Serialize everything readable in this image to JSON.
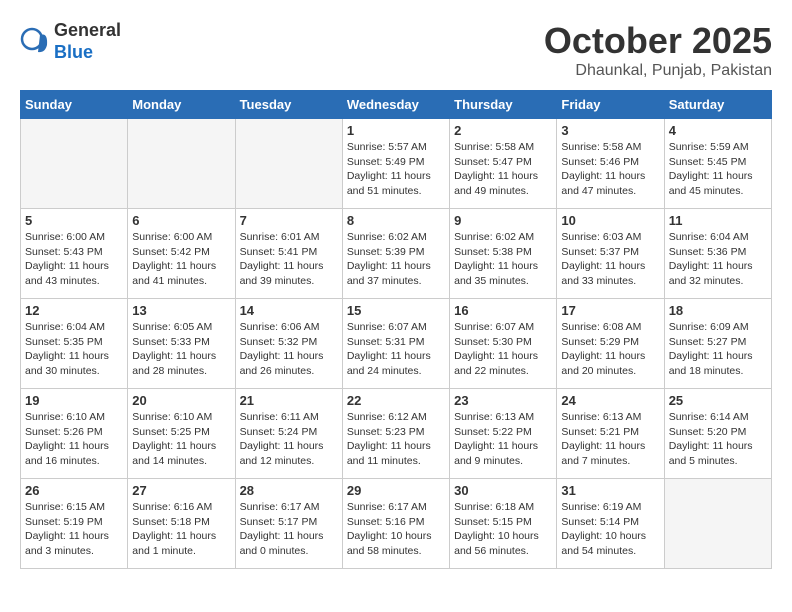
{
  "header": {
    "logo_general": "General",
    "logo_blue": "Blue",
    "month": "October 2025",
    "location": "Dhaunkal, Punjab, Pakistan"
  },
  "weekdays": [
    "Sunday",
    "Monday",
    "Tuesday",
    "Wednesday",
    "Thursday",
    "Friday",
    "Saturday"
  ],
  "weeks": [
    [
      {
        "day": "",
        "empty": true
      },
      {
        "day": "",
        "empty": true
      },
      {
        "day": "",
        "empty": true
      },
      {
        "day": "1",
        "sunrise": "Sunrise: 5:57 AM",
        "sunset": "Sunset: 5:49 PM",
        "daylight": "Daylight: 11 hours and 51 minutes."
      },
      {
        "day": "2",
        "sunrise": "Sunrise: 5:58 AM",
        "sunset": "Sunset: 5:47 PM",
        "daylight": "Daylight: 11 hours and 49 minutes."
      },
      {
        "day": "3",
        "sunrise": "Sunrise: 5:58 AM",
        "sunset": "Sunset: 5:46 PM",
        "daylight": "Daylight: 11 hours and 47 minutes."
      },
      {
        "day": "4",
        "sunrise": "Sunrise: 5:59 AM",
        "sunset": "Sunset: 5:45 PM",
        "daylight": "Daylight: 11 hours and 45 minutes."
      }
    ],
    [
      {
        "day": "5",
        "sunrise": "Sunrise: 6:00 AM",
        "sunset": "Sunset: 5:43 PM",
        "daylight": "Daylight: 11 hours and 43 minutes."
      },
      {
        "day": "6",
        "sunrise": "Sunrise: 6:00 AM",
        "sunset": "Sunset: 5:42 PM",
        "daylight": "Daylight: 11 hours and 41 minutes."
      },
      {
        "day": "7",
        "sunrise": "Sunrise: 6:01 AM",
        "sunset": "Sunset: 5:41 PM",
        "daylight": "Daylight: 11 hours and 39 minutes."
      },
      {
        "day": "8",
        "sunrise": "Sunrise: 6:02 AM",
        "sunset": "Sunset: 5:39 PM",
        "daylight": "Daylight: 11 hours and 37 minutes."
      },
      {
        "day": "9",
        "sunrise": "Sunrise: 6:02 AM",
        "sunset": "Sunset: 5:38 PM",
        "daylight": "Daylight: 11 hours and 35 minutes."
      },
      {
        "day": "10",
        "sunrise": "Sunrise: 6:03 AM",
        "sunset": "Sunset: 5:37 PM",
        "daylight": "Daylight: 11 hours and 33 minutes."
      },
      {
        "day": "11",
        "sunrise": "Sunrise: 6:04 AM",
        "sunset": "Sunset: 5:36 PM",
        "daylight": "Daylight: 11 hours and 32 minutes."
      }
    ],
    [
      {
        "day": "12",
        "sunrise": "Sunrise: 6:04 AM",
        "sunset": "Sunset: 5:35 PM",
        "daylight": "Daylight: 11 hours and 30 minutes."
      },
      {
        "day": "13",
        "sunrise": "Sunrise: 6:05 AM",
        "sunset": "Sunset: 5:33 PM",
        "daylight": "Daylight: 11 hours and 28 minutes."
      },
      {
        "day": "14",
        "sunrise": "Sunrise: 6:06 AM",
        "sunset": "Sunset: 5:32 PM",
        "daylight": "Daylight: 11 hours and 26 minutes."
      },
      {
        "day": "15",
        "sunrise": "Sunrise: 6:07 AM",
        "sunset": "Sunset: 5:31 PM",
        "daylight": "Daylight: 11 hours and 24 minutes."
      },
      {
        "day": "16",
        "sunrise": "Sunrise: 6:07 AM",
        "sunset": "Sunset: 5:30 PM",
        "daylight": "Daylight: 11 hours and 22 minutes."
      },
      {
        "day": "17",
        "sunrise": "Sunrise: 6:08 AM",
        "sunset": "Sunset: 5:29 PM",
        "daylight": "Daylight: 11 hours and 20 minutes."
      },
      {
        "day": "18",
        "sunrise": "Sunrise: 6:09 AM",
        "sunset": "Sunset: 5:27 PM",
        "daylight": "Daylight: 11 hours and 18 minutes."
      }
    ],
    [
      {
        "day": "19",
        "sunrise": "Sunrise: 6:10 AM",
        "sunset": "Sunset: 5:26 PM",
        "daylight": "Daylight: 11 hours and 16 minutes."
      },
      {
        "day": "20",
        "sunrise": "Sunrise: 6:10 AM",
        "sunset": "Sunset: 5:25 PM",
        "daylight": "Daylight: 11 hours and 14 minutes."
      },
      {
        "day": "21",
        "sunrise": "Sunrise: 6:11 AM",
        "sunset": "Sunset: 5:24 PM",
        "daylight": "Daylight: 11 hours and 12 minutes."
      },
      {
        "day": "22",
        "sunrise": "Sunrise: 6:12 AM",
        "sunset": "Sunset: 5:23 PM",
        "daylight": "Daylight: 11 hours and 11 minutes."
      },
      {
        "day": "23",
        "sunrise": "Sunrise: 6:13 AM",
        "sunset": "Sunset: 5:22 PM",
        "daylight": "Daylight: 11 hours and 9 minutes."
      },
      {
        "day": "24",
        "sunrise": "Sunrise: 6:13 AM",
        "sunset": "Sunset: 5:21 PM",
        "daylight": "Daylight: 11 hours and 7 minutes."
      },
      {
        "day": "25",
        "sunrise": "Sunrise: 6:14 AM",
        "sunset": "Sunset: 5:20 PM",
        "daylight": "Daylight: 11 hours and 5 minutes."
      }
    ],
    [
      {
        "day": "26",
        "sunrise": "Sunrise: 6:15 AM",
        "sunset": "Sunset: 5:19 PM",
        "daylight": "Daylight: 11 hours and 3 minutes."
      },
      {
        "day": "27",
        "sunrise": "Sunrise: 6:16 AM",
        "sunset": "Sunset: 5:18 PM",
        "daylight": "Daylight: 11 hours and 1 minute."
      },
      {
        "day": "28",
        "sunrise": "Sunrise: 6:17 AM",
        "sunset": "Sunset: 5:17 PM",
        "daylight": "Daylight: 11 hours and 0 minutes."
      },
      {
        "day": "29",
        "sunrise": "Sunrise: 6:17 AM",
        "sunset": "Sunset: 5:16 PM",
        "daylight": "Daylight: 10 hours and 58 minutes."
      },
      {
        "day": "30",
        "sunrise": "Sunrise: 6:18 AM",
        "sunset": "Sunset: 5:15 PM",
        "daylight": "Daylight: 10 hours and 56 minutes."
      },
      {
        "day": "31",
        "sunrise": "Sunrise: 6:19 AM",
        "sunset": "Sunset: 5:14 PM",
        "daylight": "Daylight: 10 hours and 54 minutes."
      },
      {
        "day": "",
        "empty": true
      }
    ]
  ]
}
